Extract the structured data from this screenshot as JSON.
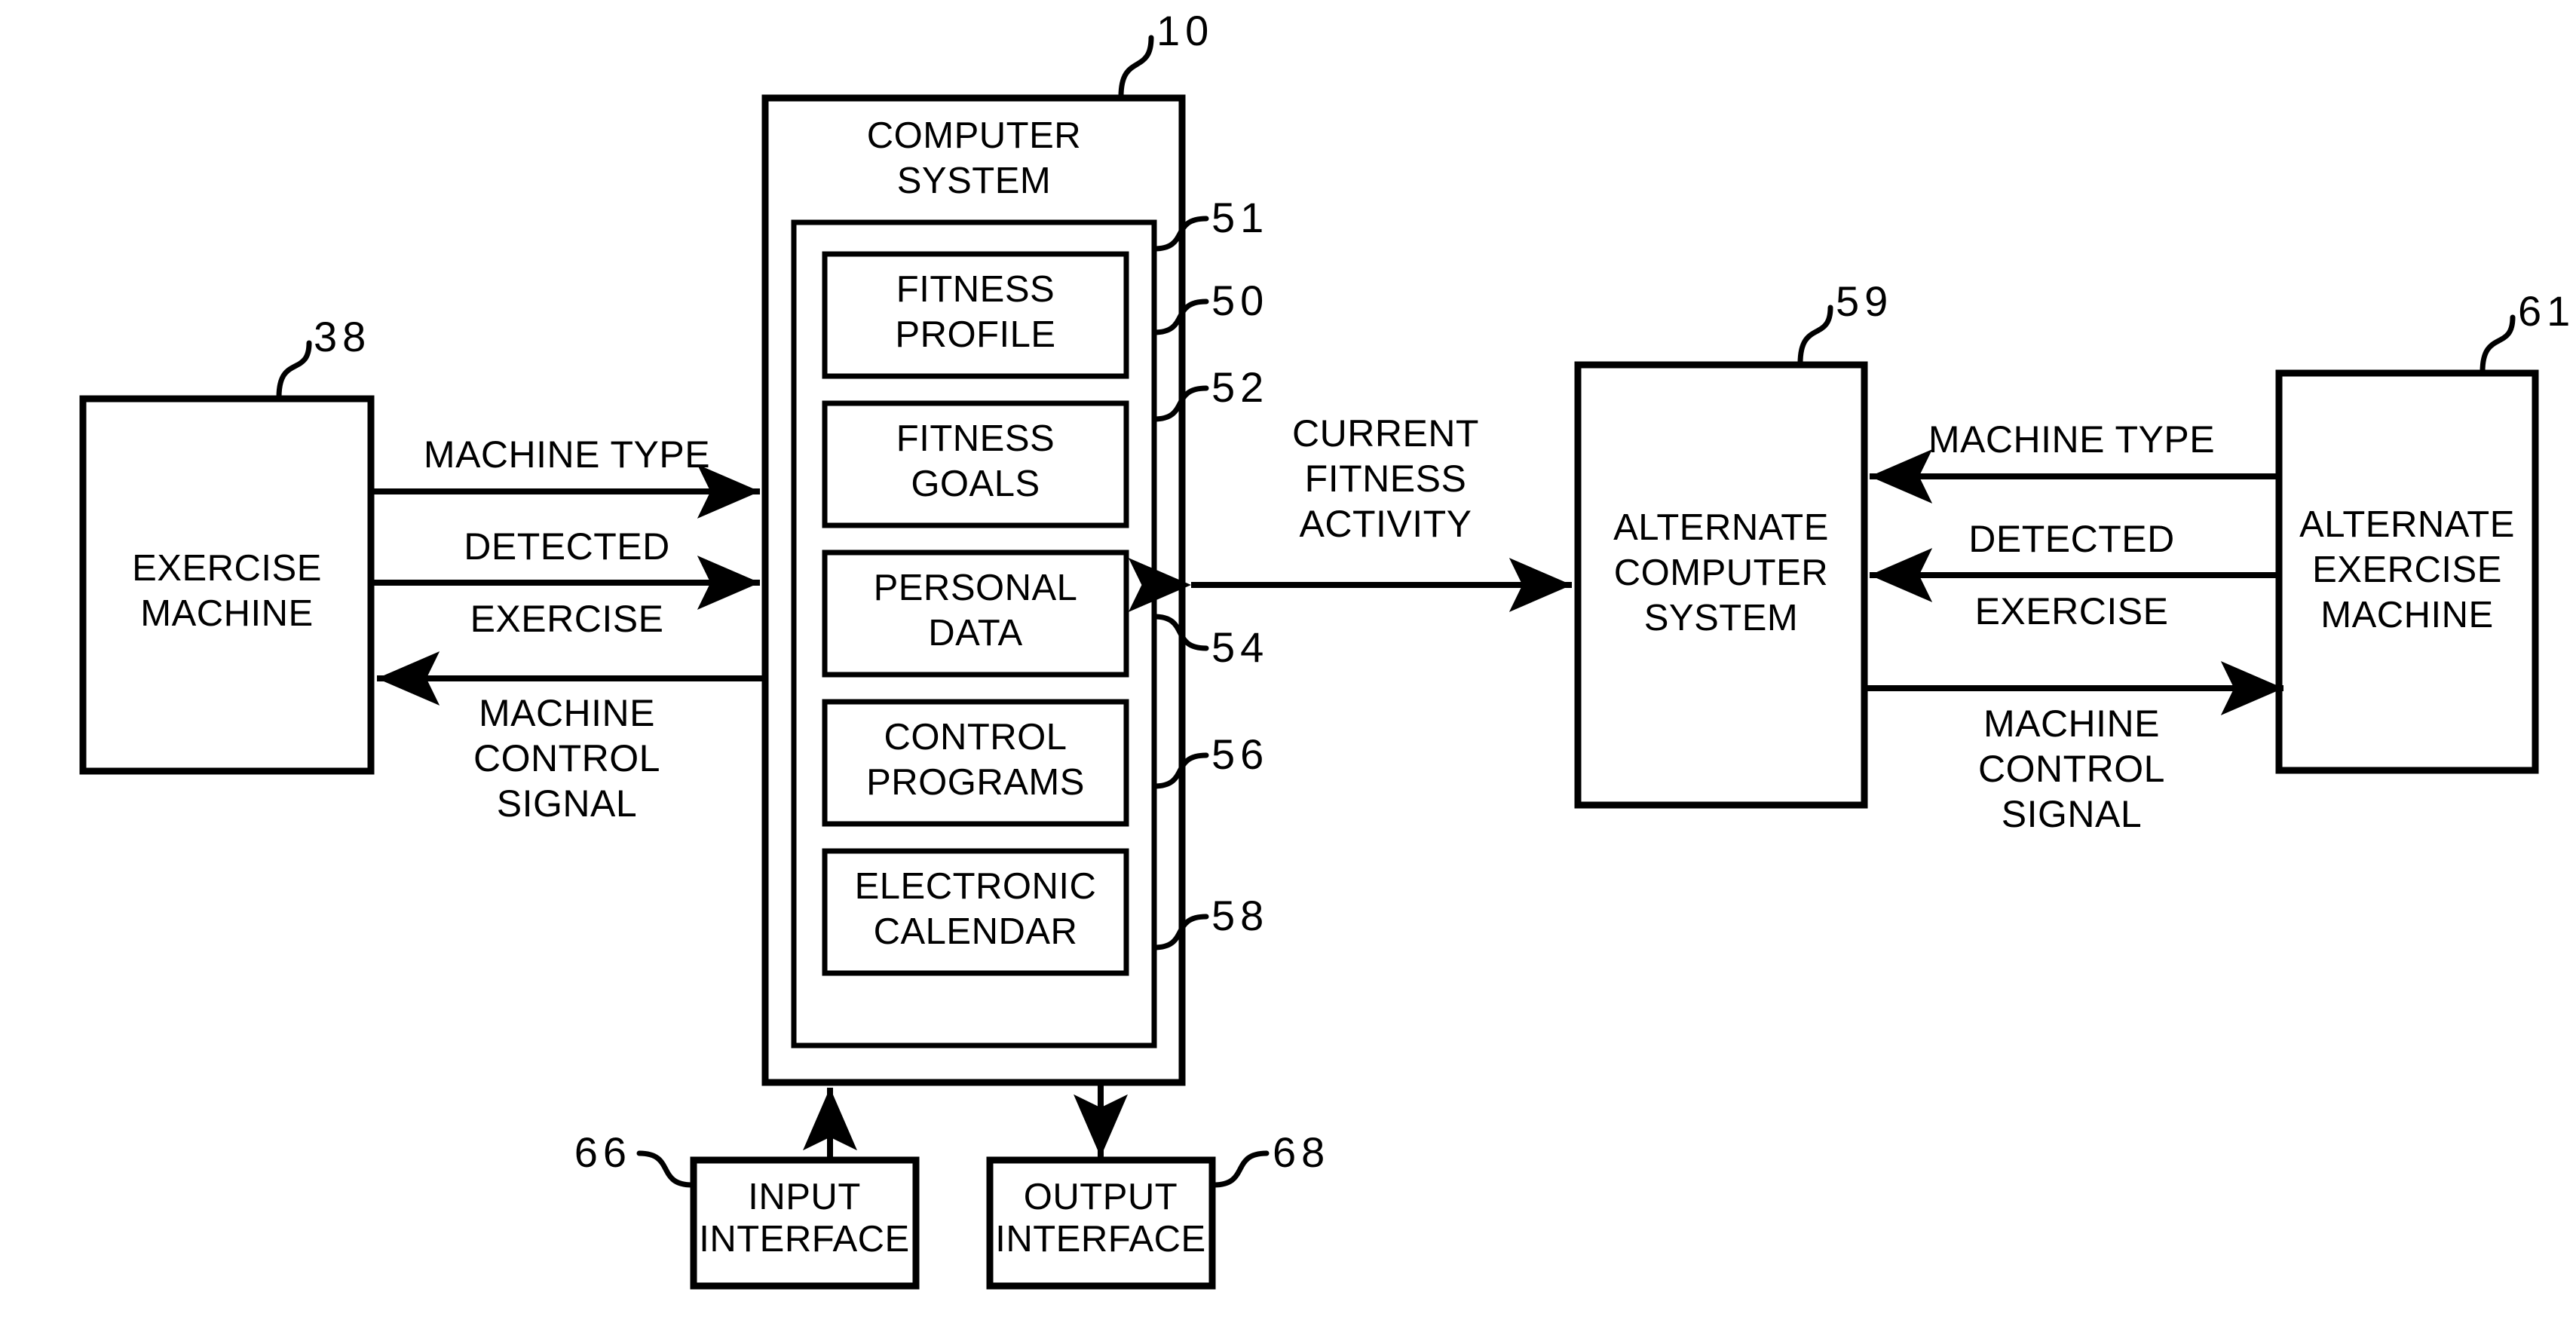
{
  "figure": {
    "type": "patent-block-diagram",
    "background_color": "#ffffff",
    "line_color": "#000000"
  },
  "blocks": {
    "computer_system": {
      "title_line1": "COMPUTER",
      "title_line2": "SYSTEM",
      "ref": "10",
      "modules": [
        {
          "line1": "FITNESS",
          "line2": "PROFILE",
          "ref": "50"
        },
        {
          "line1": "FITNESS",
          "line2": "GOALS",
          "ref": "52"
        },
        {
          "line1": "PERSONAL",
          "line2": "DATA",
          "ref": "54"
        },
        {
          "line1": "CONTROL",
          "line2": "PROGRAMS",
          "ref": "56"
        },
        {
          "line1": "ELECTRONIC",
          "line2": "CALENDAR",
          "ref": "58"
        }
      ],
      "container_ref": "51"
    },
    "exercise_machine": {
      "line1": "EXERCISE",
      "line2": "MACHINE",
      "ref": "38"
    },
    "alternate_computer_system": {
      "line1": "ALTERNATE",
      "line2": "COMPUTER",
      "line3": "SYSTEM",
      "ref": "59"
    },
    "alternate_exercise_machine": {
      "line1": "ALTERNATE",
      "line2": "EXERCISE",
      "line3": "MACHINE",
      "ref": "61"
    },
    "input_interface": {
      "line1": "INPUT",
      "line2": "INTERFACE",
      "ref": "66"
    },
    "output_interface": {
      "line1": "OUTPUT",
      "line2": "INTERFACE",
      "ref": "68"
    }
  },
  "flows": {
    "left_machine_type": {
      "label": "MACHINE TYPE",
      "direction": "right"
    },
    "left_detected_exercise": {
      "line1": "DETECTED",
      "line2": "EXERCISE",
      "direction": "right"
    },
    "left_machine_control": {
      "line1": "MACHINE",
      "line2": "CONTROL",
      "line3": "SIGNAL",
      "direction": "left"
    },
    "center_current_fitness": {
      "line1": "CURRENT",
      "line2": "FITNESS",
      "line3": "ACTIVITY",
      "direction": "both"
    },
    "right_machine_type": {
      "label": "MACHINE TYPE",
      "direction": "left"
    },
    "right_detected_exercise": {
      "line1": "DETECTED",
      "line2": "EXERCISE",
      "direction": "left"
    },
    "right_machine_control": {
      "line1": "MACHINE",
      "line2": "CONTROL",
      "line3": "SIGNAL",
      "direction": "right"
    }
  }
}
